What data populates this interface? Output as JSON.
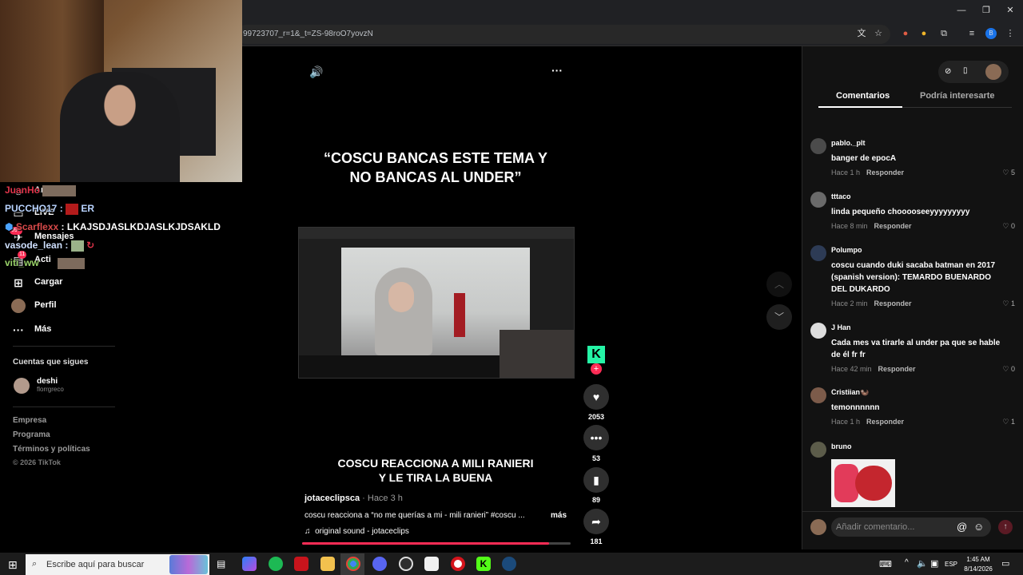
{
  "browser": {
    "url": "99723707_r=1&_t=ZS-98roO7yovzN",
    "icons": [
      "translate-icon",
      "star-icon",
      "extension-icon",
      "profile-icon",
      "menu-icon"
    ]
  },
  "chat": {
    "lines": [
      {
        "user": "JuanHo",
        "text": ""
      },
      {
        "user": "PUCCHO17",
        "text": "ER"
      },
      {
        "user": "Scarflexx",
        "text": "LKAJSDJASLKDJASLKJDSAKLD"
      },
      {
        "user": "vasode_lean",
        "text": ""
      },
      {
        "user": "viti_ww",
        "text": ""
      }
    ]
  },
  "sidebar": {
    "items": [
      {
        "label": "Ami",
        "icon": "friends-icon"
      },
      {
        "label": "LIVE",
        "icon": "live-icon"
      },
      {
        "label": "Mensajes",
        "icon": "messages-icon",
        "badge": "99+"
      },
      {
        "label": "Acti",
        "icon": "activity-icon",
        "badge": "11"
      },
      {
        "label": "Cargar",
        "icon": "plus-icon"
      },
      {
        "label": "Perfil",
        "icon": "avatar"
      },
      {
        "label": "Más",
        "icon": "more-icon"
      }
    ],
    "following_title": "Cuentas que sigues",
    "following": [
      {
        "name": "deshi",
        "handle": "florrgreco"
      }
    ],
    "footer": [
      "Empresa",
      "Programa",
      "Términos y políticas",
      "© 2026 TikTok"
    ]
  },
  "video": {
    "caption_top": "“COSCU BANCAS ESTE TEMA Y NO BANCAS AL UNDER”",
    "caption_bottom": "COSCU REACCIONA A MILI RANIERI Y LE TIRA LA BUENA",
    "author": "jotaceclipsca",
    "time": "· Hace 3 h",
    "description": "coscu reacciona a “no me querías a mi - mili ranieri” #coscu ...",
    "more": "más",
    "sound": "original sound - jotaceclips",
    "progress": 0.92,
    "actions": [
      {
        "name": "like",
        "count": "2053"
      },
      {
        "name": "comment",
        "count": "53"
      },
      {
        "name": "save",
        "count": "89"
      },
      {
        "name": "share",
        "count": "181"
      }
    ]
  },
  "comments_panel": {
    "tabs": [
      "Comentarios",
      "Podría interesarte"
    ],
    "reply_label": "Responder",
    "comments": [
      {
        "user": "pablo._plt",
        "text": "banger de epocA",
        "time": "Hace 1 h",
        "likes": "5"
      },
      {
        "user": "tttaco",
        "text": "linda pequeño chooooseeyyyyyyyyy",
        "time": "Hace 8 min",
        "likes": "0"
      },
      {
        "user": "Polumpo",
        "text": "coscu cuando duki sacaba batman en 2017 (spanish version): TEMARDO BUENARDO DEL DUKARDO",
        "time": "Hace 2 min",
        "likes": "1"
      },
      {
        "user": "J Han",
        "text": "Cada mes va tirarle al under pa que se hable de él fr fr",
        "time": "Hace 42 min",
        "likes": "0"
      },
      {
        "user": "Cristiian🦦",
        "text": "temonnnnnn",
        "time": "Hace 1 h",
        "likes": "1"
      },
      {
        "user": "bruno",
        "text": "",
        "time": "",
        "likes": ""
      }
    ],
    "input_placeholder": "Añadir comentario..."
  },
  "taskbar": {
    "search_placeholder": "Escribe aquí para buscar",
    "lang": "ESP",
    "time": "1:45 AM",
    "date": "8/14/2026"
  }
}
